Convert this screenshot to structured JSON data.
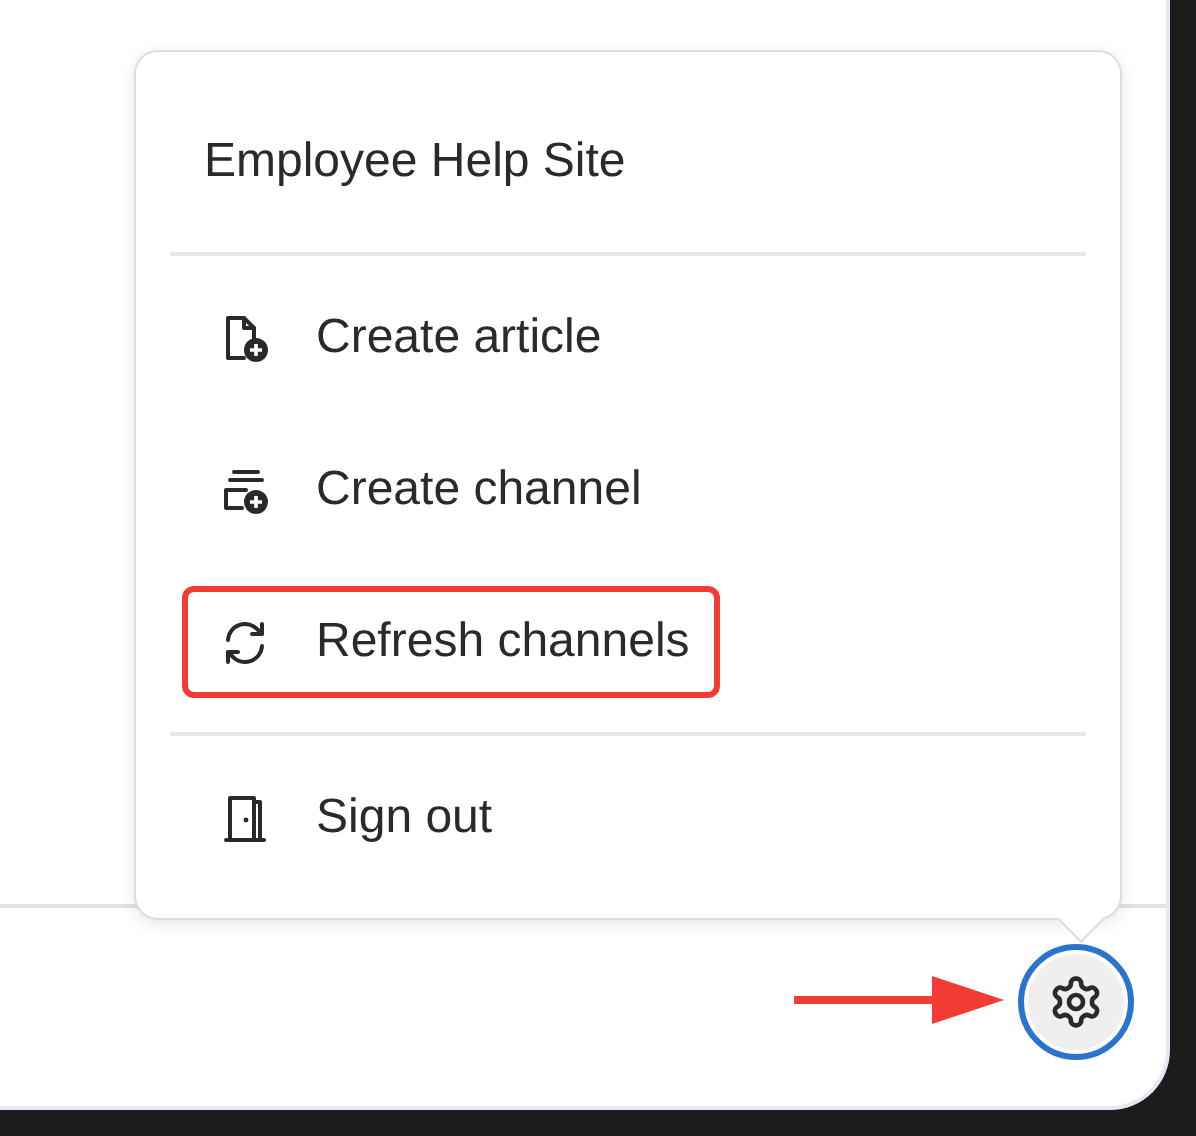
{
  "menu": {
    "title": "Employee Help Site",
    "sections": [
      [
        {
          "label": "Create article",
          "kind": "article",
          "highlighted": false
        },
        {
          "label": "Create channel",
          "kind": "channel",
          "highlighted": false
        },
        {
          "label": "Refresh channels",
          "kind": "refresh",
          "highlighted": true
        }
      ],
      [
        {
          "label": "Sign out",
          "kind": "signout",
          "highlighted": false
        }
      ]
    ]
  },
  "settings_button": {
    "focused": true,
    "pointed_at": true
  }
}
